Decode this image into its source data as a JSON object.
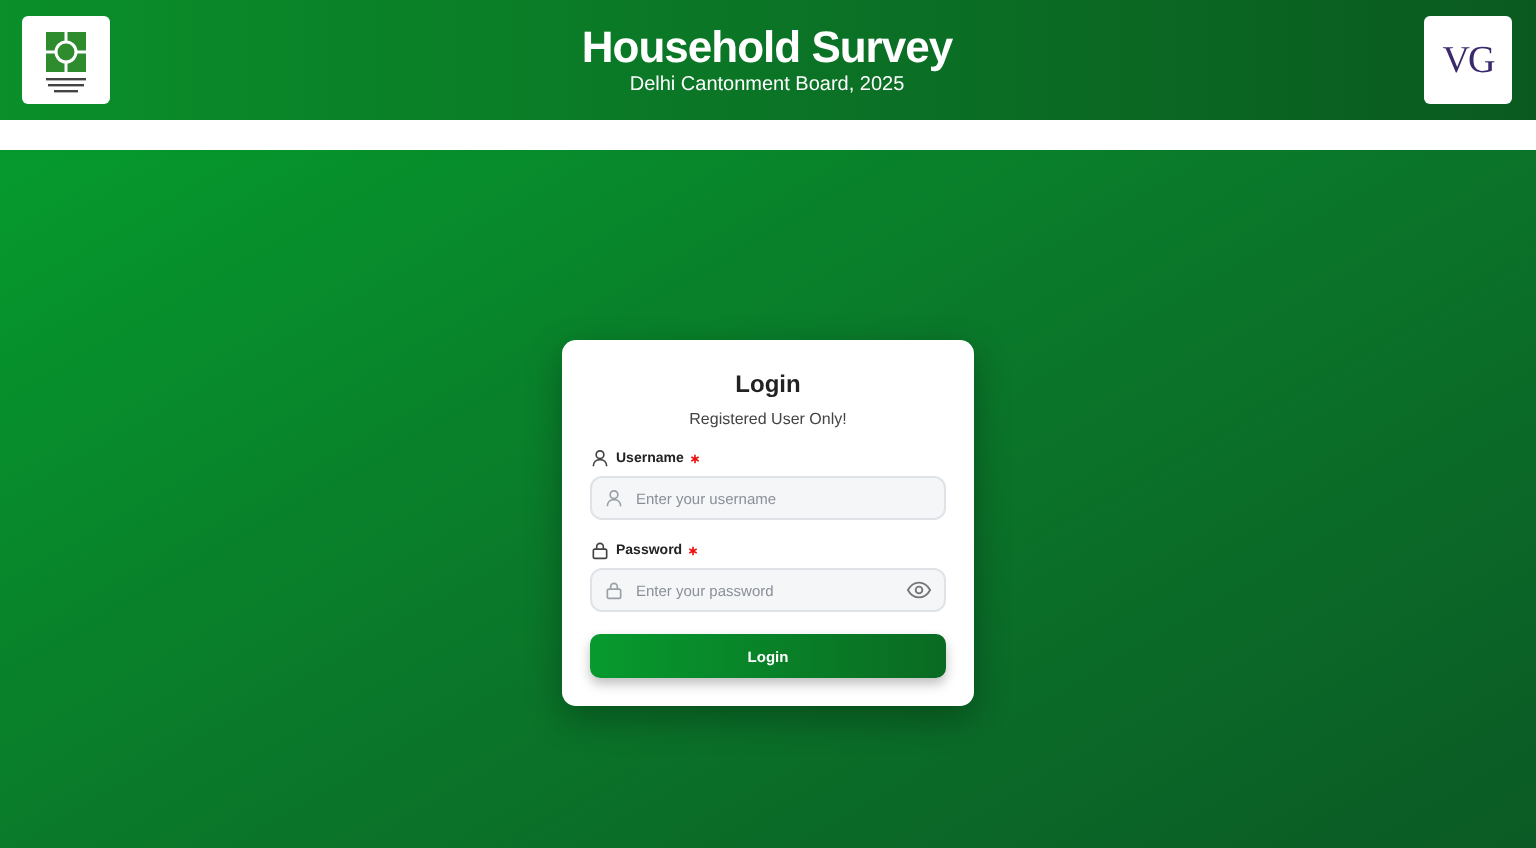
{
  "header": {
    "title": "Household Survey",
    "subtitle": "Delhi Cantonment Board, 2025",
    "right_logo": {
      "text": "VG"
    }
  },
  "login": {
    "title": "Login",
    "subtitle": "Registered User Only!",
    "fields": [
      {
        "kind": "text",
        "label": "Username",
        "required": true,
        "placeholder": "Enter your username"
      },
      {
        "kind": "password",
        "label": "Password",
        "required": true,
        "placeholder": "Enter your password"
      }
    ],
    "button": "Login"
  }
}
